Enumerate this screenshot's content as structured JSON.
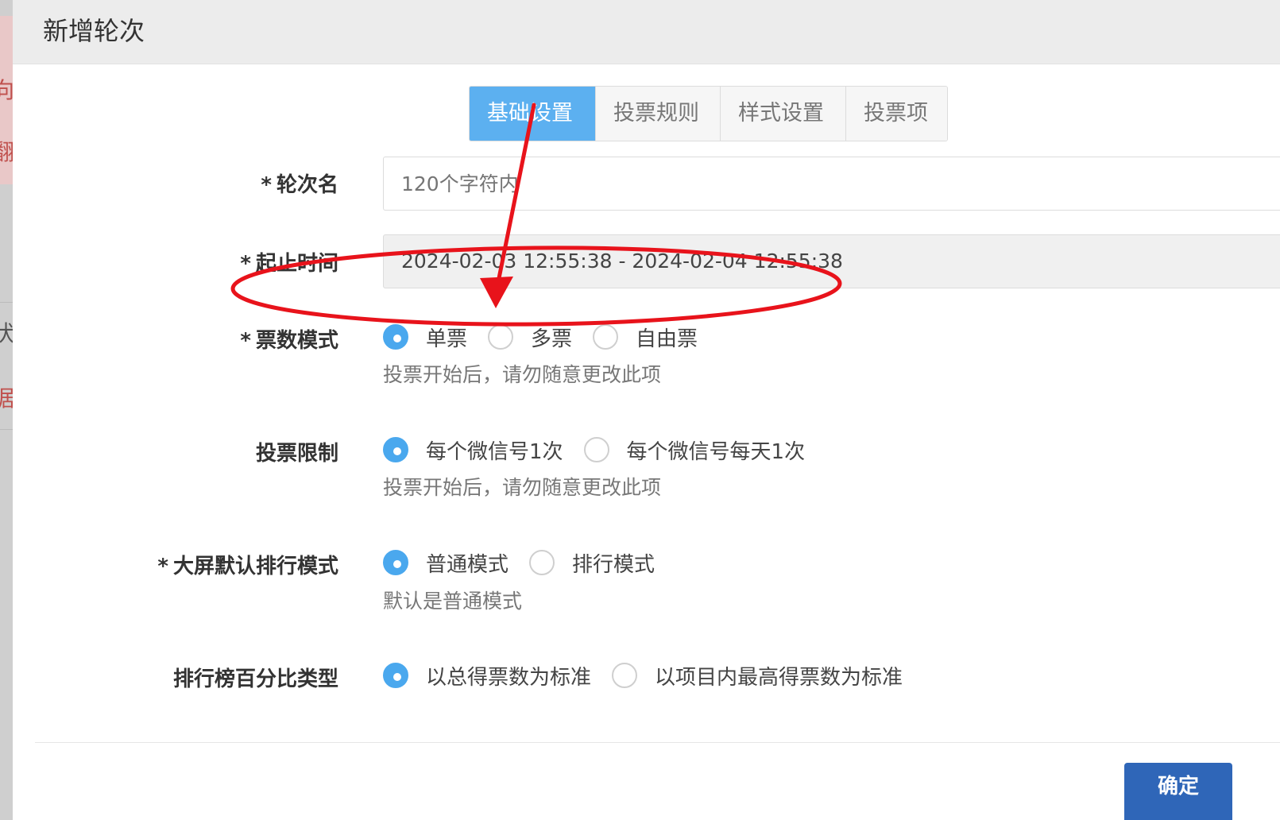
{
  "modal": {
    "title": "新增轮次"
  },
  "tabs": [
    {
      "label": "基础设置",
      "active": true
    },
    {
      "label": "投票规则",
      "active": false
    },
    {
      "label": "样式设置",
      "active": false
    },
    {
      "label": "投票项",
      "active": false
    }
  ],
  "form": {
    "round_name": {
      "required": "*",
      "label": "轮次名",
      "placeholder": "120个字符内",
      "value": ""
    },
    "time_range": {
      "required": "*",
      "label": "起止时间",
      "value": "2024-02-03 12:55:38 - 2024-02-04 12:55:38"
    },
    "vote_mode": {
      "required": "*",
      "label": "票数模式",
      "options": [
        "单票",
        "多票",
        "自由票"
      ],
      "selected": 0,
      "hint": "投票开始后，请勿随意更改此项"
    },
    "vote_limit": {
      "label": "投票限制",
      "options": [
        "每个微信号1次",
        "每个微信号每天1次"
      ],
      "selected": 0,
      "hint": "投票开始后，请勿随意更改此项"
    },
    "screen_rank_mode": {
      "required": "*",
      "label": "大屏默认排行模式",
      "options": [
        "普通模式",
        "排行模式"
      ],
      "selected": 0,
      "hint": "默认是普通模式"
    },
    "rank_percent_type": {
      "label": "排行榜百分比类型",
      "options": [
        "以总得票数为标准",
        "以项目内最高得票数为标准"
      ],
      "selected": 0
    }
  },
  "footer": {
    "confirm_label": "确定"
  },
  "background": {
    "fragments": [
      "向",
      "翻",
      "状态",
      "据"
    ]
  },
  "colors": {
    "accent": "#5cb0f0",
    "radio_checked": "#4aa8ee",
    "confirm": "#2f66b8",
    "annotation": "#e8131b"
  }
}
